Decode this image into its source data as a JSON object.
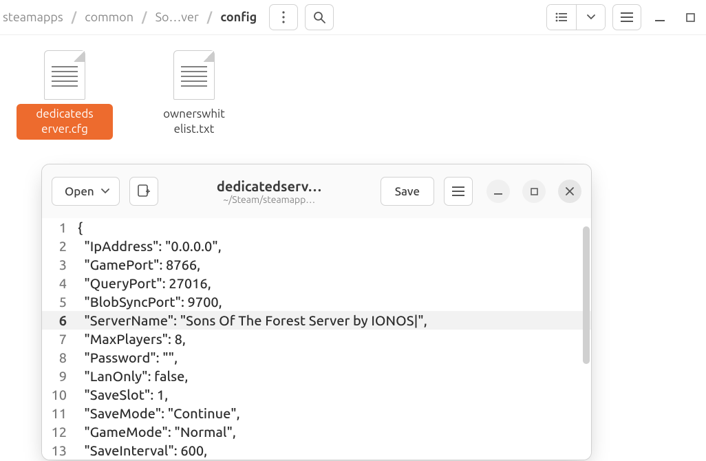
{
  "file_manager": {
    "breadcrumb": {
      "items": [
        "steamapps",
        "common",
        "So…ver",
        "config"
      ],
      "current_index": 3
    },
    "files": [
      {
        "label": "dedicateds erver.cfg",
        "selected": true
      },
      {
        "label": "ownerswhit elist.txt",
        "selected": false
      }
    ]
  },
  "editor": {
    "open_label": "Open",
    "save_label": "Save",
    "title": "dedicatedserv…",
    "subtitle": "~/Steam/steamapp…",
    "cursor_line": 6,
    "lines": [
      "{",
      "  \"IpAddress\": \"0.0.0.0\",",
      "  \"GamePort\": 8766,",
      "  \"QueryPort\": 27016,",
      "  \"BlobSyncPort\": 9700,",
      "  \"ServerName\": \"Sons Of The Forest Server by IONOS|\",",
      "  \"MaxPlayers\": 8,",
      "  \"Password\": \"\",",
      "  \"LanOnly\": false,",
      "  \"SaveSlot\": 1,",
      "  \"SaveMode\": \"Continue\",",
      "  \"GameMode\": \"Normal\",",
      "  \"SaveInterval\": 600,"
    ]
  }
}
